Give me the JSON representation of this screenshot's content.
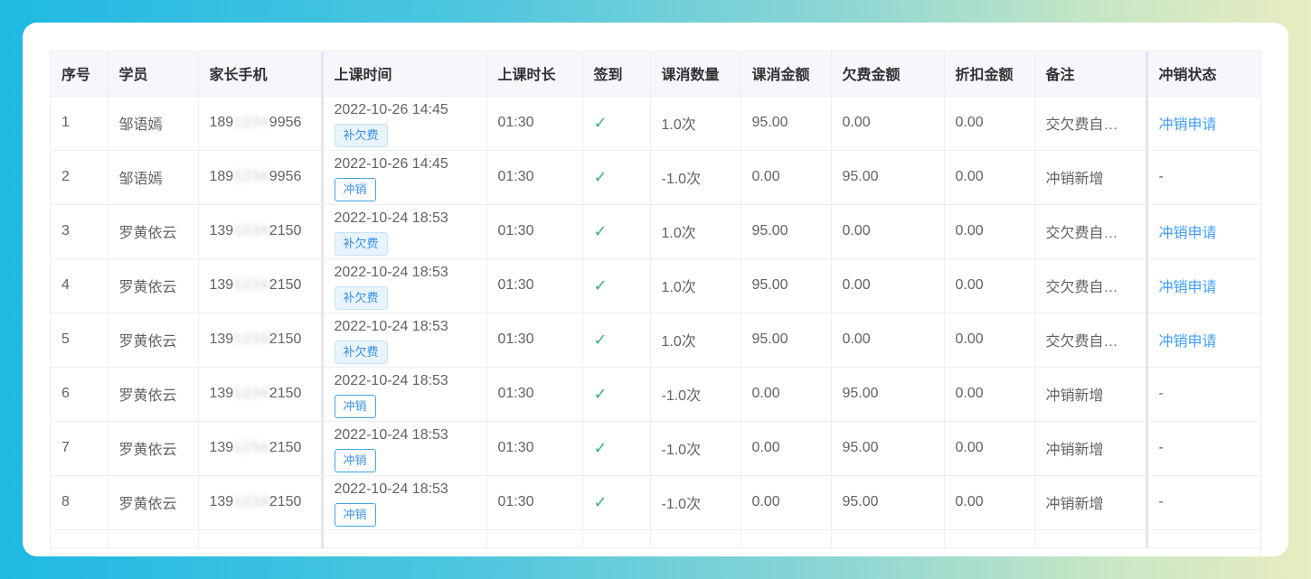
{
  "table": {
    "headers": {
      "index": "序号",
      "student": "学员",
      "phone": "家长手机",
      "time": "上课时间",
      "duration": "上课时长",
      "signin": "签到",
      "count": "课消数量",
      "amount": "课消金额",
      "owed": "欠费金额",
      "discount": "折扣金额",
      "note": "备注",
      "status": "冲销状态"
    },
    "check_glyph": "✓",
    "rows": [
      {
        "index": "1",
        "student": "邹语嫣",
        "phone_pre": "189",
        "phone_mid": "1234",
        "phone_post": "9956",
        "time": "2022-10-26 14:45",
        "tag": "补欠费",
        "tag_style": "fill",
        "duration": "01:30",
        "count": "1.0次",
        "amount": "95.00",
        "owed": "0.00",
        "discount": "0.00",
        "note": "交欠费自…",
        "status": "冲销申请",
        "status_link": true
      },
      {
        "index": "2",
        "student": "邹语嫣",
        "phone_pre": "189",
        "phone_mid": "1234",
        "phone_post": "9956",
        "time": "2022-10-26 14:45",
        "tag": "冲销",
        "tag_style": "plain",
        "duration": "01:30",
        "count": "-1.0次",
        "amount": "0.00",
        "owed": "95.00",
        "discount": "0.00",
        "note": "冲销新增",
        "status": "-",
        "status_link": false
      },
      {
        "index": "3",
        "student": "罗黄依云",
        "phone_pre": "139",
        "phone_mid": "1234",
        "phone_post": "2150",
        "time": "2022-10-24 18:53",
        "tag": "补欠费",
        "tag_style": "fill",
        "duration": "01:30",
        "count": "1.0次",
        "amount": "95.00",
        "owed": "0.00",
        "discount": "0.00",
        "note": "交欠费自…",
        "status": "冲销申请",
        "status_link": true
      },
      {
        "index": "4",
        "student": "罗黄依云",
        "phone_pre": "139",
        "phone_mid": "1234",
        "phone_post": "2150",
        "time": "2022-10-24 18:53",
        "tag": "补欠费",
        "tag_style": "fill",
        "duration": "01:30",
        "count": "1.0次",
        "amount": "95.00",
        "owed": "0.00",
        "discount": "0.00",
        "note": "交欠费自…",
        "status": "冲销申请",
        "status_link": true
      },
      {
        "index": "5",
        "student": "罗黄依云",
        "phone_pre": "139",
        "phone_mid": "1234",
        "phone_post": "2150",
        "time": "2022-10-24 18:53",
        "tag": "补欠费",
        "tag_style": "fill",
        "duration": "01:30",
        "count": "1.0次",
        "amount": "95.00",
        "owed": "0.00",
        "discount": "0.00",
        "note": "交欠费自…",
        "status": "冲销申请",
        "status_link": true
      },
      {
        "index": "6",
        "student": "罗黄依云",
        "phone_pre": "139",
        "phone_mid": "1234",
        "phone_post": "2150",
        "time": "2022-10-24 18:53",
        "tag": "冲销",
        "tag_style": "plain",
        "duration": "01:30",
        "count": "-1.0次",
        "amount": "0.00",
        "owed": "95.00",
        "discount": "0.00",
        "note": "冲销新增",
        "status": "-",
        "status_link": false
      },
      {
        "index": "7",
        "student": "罗黄依云",
        "phone_pre": "139",
        "phone_mid": "1234",
        "phone_post": "2150",
        "time": "2022-10-24 18:53",
        "tag": "冲销",
        "tag_style": "plain",
        "duration": "01:30",
        "count": "-1.0次",
        "amount": "0.00",
        "owed": "95.00",
        "discount": "0.00",
        "note": "冲销新增",
        "status": "-",
        "status_link": false
      },
      {
        "index": "8",
        "student": "罗黄依云",
        "phone_pre": "139",
        "phone_mid": "1234",
        "phone_post": "2150",
        "time": "2022-10-24 18:53",
        "tag": "冲销",
        "tag_style": "plain",
        "duration": "01:30",
        "count": "-1.0次",
        "amount": "0.00",
        "owed": "95.00",
        "discount": "0.00",
        "note": "冲销新增",
        "status": "-",
        "status_link": false
      }
    ]
  }
}
